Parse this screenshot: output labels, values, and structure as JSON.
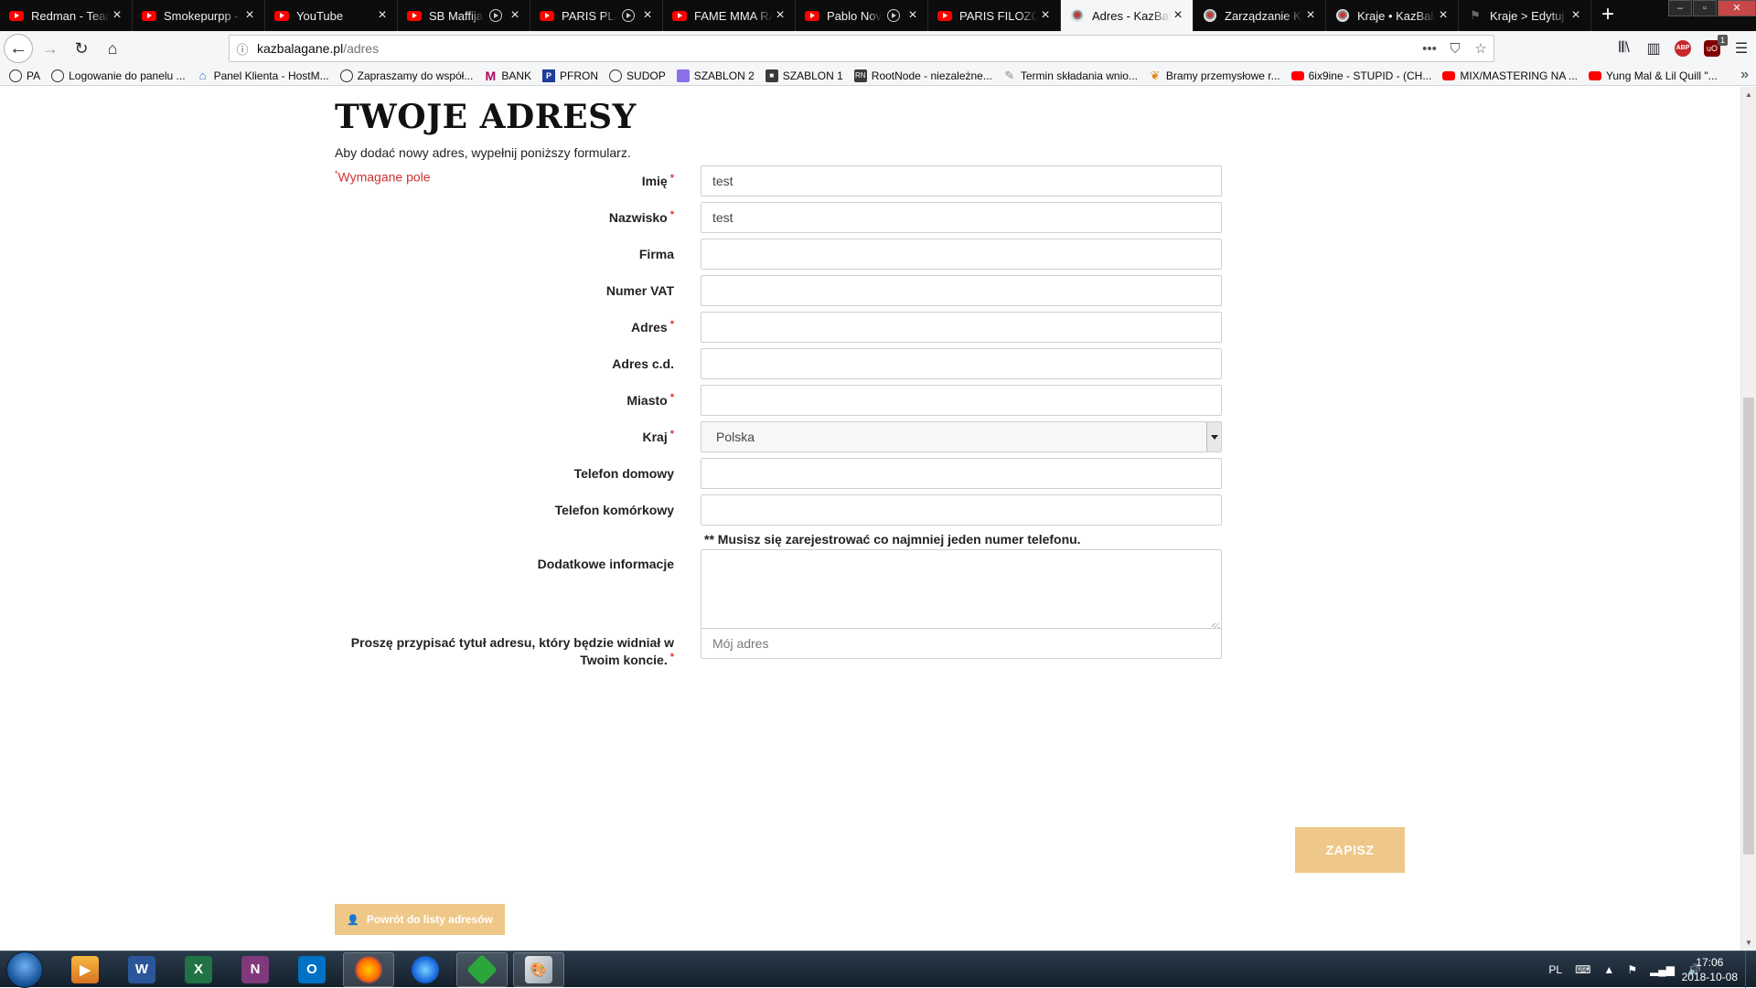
{
  "browser": {
    "tabs": [
      {
        "title": "Redman - Tear It",
        "icon": "youtube-icon",
        "active": false,
        "playing": false
      },
      {
        "title": "Smokepurpp - So",
        "icon": "youtube-icon",
        "active": false,
        "playing": false
      },
      {
        "title": "YouTube",
        "icon": "youtube-icon",
        "active": false,
        "playing": false
      },
      {
        "title": "SB Maffija - Y",
        "icon": "youtube-icon",
        "active": false,
        "playing": true
      },
      {
        "title": "PARIS PLATY",
        "icon": "youtube-icon",
        "active": false,
        "playing": true
      },
      {
        "title": "FAME MMA RAND",
        "icon": "youtube-icon",
        "active": false,
        "playing": false
      },
      {
        "title": "Pablo Novac",
        "icon": "youtube-icon",
        "active": false,
        "playing": true
      },
      {
        "title": "PARIS FILOZOFIA",
        "icon": "youtube-icon",
        "active": false,
        "playing": false
      },
      {
        "title": "Adres - KazBalagane",
        "icon": "site-icon",
        "active": true,
        "playing": false
      },
      {
        "title": "Zarządzanie Klientami",
        "icon": "site-icon",
        "active": false,
        "playing": false
      },
      {
        "title": "Kraje • KazBalagane",
        "icon": "site-icon",
        "active": false,
        "playing": false
      },
      {
        "title": "Kraje > Edytuj",
        "icon": "edit-icon",
        "active": false,
        "playing": false
      }
    ],
    "new_tab": "+",
    "url_host": "kazbalagane.pl",
    "url_path": "/adres",
    "url_actions": [
      "more-icon",
      "pocket-icon",
      "bookmark-star-icon"
    ],
    "toolbar_right": {
      "ublock_badge": "1",
      "abp_label": "ABP",
      "ublock_label": "uO"
    },
    "bookmarks": [
      {
        "label": "PA",
        "icon": "globe-icon"
      },
      {
        "label": "Logowanie do panelu ...",
        "icon": "globe-icon"
      },
      {
        "label": "Panel Klienta - HostM...",
        "icon": "home-icon"
      },
      {
        "label": "Zapraszamy do współ...",
        "icon": "globe-icon"
      },
      {
        "label": "BANK",
        "icon": "bank-icon"
      },
      {
        "label": "PFRON",
        "icon": "pfron-icon"
      },
      {
        "label": "SUDOP",
        "icon": "globe-icon"
      },
      {
        "label": "SZABLON 2",
        "icon": "template-icon"
      },
      {
        "label": "SZABLON 1",
        "icon": "template-dark-icon"
      },
      {
        "label": "RootNode - niezależne...",
        "icon": "rootnode-icon"
      },
      {
        "label": "Termin składania wnio...",
        "icon": "pen-icon"
      },
      {
        "label": "Bramy przemysłowe r...",
        "icon": "leaf-icon"
      },
      {
        "label": "6ix9ine - STUPID - (CH...",
        "icon": "youtube-icon"
      },
      {
        "label": "MIX/MASTERING NA ...",
        "icon": "youtube-icon"
      },
      {
        "label": "Yung Mal & Lil Quill \"...",
        "icon": "youtube-icon"
      }
    ]
  },
  "page": {
    "heading": "TWOJE ADRESY",
    "intro": "Aby dodać nowy adres, wypełnij poniższy formularz.",
    "required_note": "Wymagane pole",
    "required_mark": "*",
    "fields": {
      "firstname": {
        "label": "Imię",
        "required": true,
        "value": "test"
      },
      "lastname": {
        "label": "Nazwisko",
        "required": true,
        "value": "test"
      },
      "company": {
        "label": "Firma",
        "required": false,
        "value": ""
      },
      "vat": {
        "label": "Numer VAT",
        "required": false,
        "value": ""
      },
      "address1": {
        "label": "Adres",
        "required": true,
        "value": ""
      },
      "address2": {
        "label": "Adres c.d.",
        "required": false,
        "value": ""
      },
      "city": {
        "label": "Miasto",
        "required": true,
        "value": ""
      },
      "country": {
        "label": "Kraj",
        "required": true,
        "value": "Polska"
      },
      "phone": {
        "label": "Telefon domowy",
        "required": false,
        "value": ""
      },
      "mobile": {
        "label": "Telefon komórkowy",
        "required": false,
        "value": ""
      },
      "other": {
        "label": "Dodatkowe informacje",
        "required": false,
        "value": ""
      },
      "alias": {
        "label": "Proszę przypisać tytuł adresu, który będzie widniał w Twoim koncie.",
        "required": true,
        "placeholder": "Mój adres"
      }
    },
    "phone_note": "** Musisz się zarejestrować co najmniej jeden numer telefonu.",
    "save_label": "ZAPISZ",
    "back_label": "Powrót do listy adresów",
    "accent_color": "#efc889",
    "required_color": "#cc3333"
  },
  "taskbar": {
    "apps": [
      {
        "name": "media-player-icon",
        "active": false
      },
      {
        "name": "word-icon",
        "active": false
      },
      {
        "name": "excel-icon",
        "active": false
      },
      {
        "name": "onenote-icon",
        "active": false
      },
      {
        "name": "outlook-icon",
        "active": false
      },
      {
        "name": "firefox-icon",
        "active": true
      },
      {
        "name": "firefox-dev-icon",
        "active": false
      },
      {
        "name": "download-manager-icon",
        "active": false
      },
      {
        "name": "paint-icon",
        "active": false
      }
    ],
    "language": "PL",
    "time": "17:06",
    "date": "2018-10-08"
  }
}
